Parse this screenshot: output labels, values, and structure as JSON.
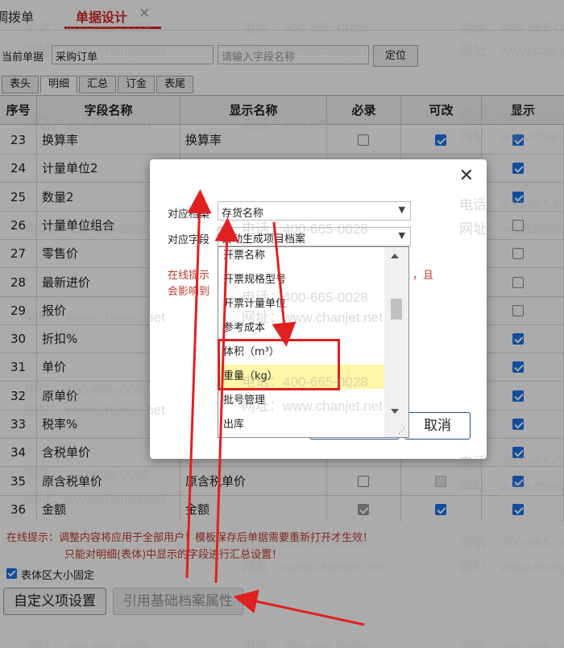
{
  "top_tabs": {
    "prev": "调拨单",
    "active": "单据设计",
    "close": "×"
  },
  "current": {
    "label": "当前单据",
    "value": "采购订单",
    "search_placeholder": "请输入字段名称",
    "locate": "定位"
  },
  "sub_tabs": [
    "表头",
    "明细",
    "汇总",
    "订金",
    "表尾"
  ],
  "table": {
    "headers": [
      "序号",
      "字段名称",
      "显示名称",
      "必录",
      "可改",
      "显示"
    ],
    "rows": [
      {
        "no": "23",
        "field": "换算率",
        "disp": "换算率",
        "req": "off",
        "edit": "on",
        "show": "on"
      },
      {
        "no": "24",
        "field": "计量单位2",
        "disp": "",
        "req": "none",
        "edit": "none",
        "show": "on"
      },
      {
        "no": "25",
        "field": "数量2",
        "disp": "",
        "req": "none",
        "edit": "none",
        "show": "on"
      },
      {
        "no": "26",
        "field": "计量单位组合",
        "disp": "",
        "req": "none",
        "edit": "none",
        "show": "off"
      },
      {
        "no": "27",
        "field": "零售价",
        "disp": "",
        "req": "none",
        "edit": "none",
        "show": "off"
      },
      {
        "no": "28",
        "field": "最新进价",
        "disp": "",
        "req": "none",
        "edit": "none",
        "show": "off"
      },
      {
        "no": "29",
        "field": "报价",
        "disp": "",
        "req": "none",
        "edit": "none",
        "show": "off"
      },
      {
        "no": "30",
        "field": "折扣%",
        "disp": "",
        "req": "none",
        "edit": "none",
        "show": "on"
      },
      {
        "no": "31",
        "field": "单价",
        "disp": "",
        "req": "none",
        "edit": "none",
        "show": "on"
      },
      {
        "no": "32",
        "field": "原单价",
        "disp": "",
        "req": "none",
        "edit": "none",
        "show": "on"
      },
      {
        "no": "33",
        "field": "税率%",
        "disp": "",
        "req": "none",
        "edit": "none",
        "show": "on"
      },
      {
        "no": "34",
        "field": "含税单价",
        "disp": "含税单价",
        "req": "dison",
        "edit": "on",
        "show": "on"
      },
      {
        "no": "35",
        "field": "原含税单价",
        "disp": "原含税单价",
        "req": "off",
        "edit": "dis",
        "show": "on"
      },
      {
        "no": "36",
        "field": "金额",
        "disp": "金额",
        "req": "dison",
        "edit": "on",
        "show": "on"
      }
    ]
  },
  "tips": {
    "line1": "在线提示：调整内容将应用于全部用户！模板保存后单据需要重新打开才生效！",
    "line2": "只能对明细(表体)中显示的字段进行汇总设置！",
    "fixed_label": "表体区大小固定"
  },
  "buttons": {
    "custom": "自定义项设置",
    "ref": "引用基础档案属性"
  },
  "modal": {
    "close": "✕",
    "archive_label": "对应档案",
    "archive_value": "存货名称",
    "field_label": "对应字段",
    "field_value": "自动生成项目档案",
    "tip_left1": "在线提示",
    "tip_left2": "会影响到",
    "tip_right": "，且",
    "cancel": "取消"
  },
  "dropdown": {
    "items": [
      "开票名称",
      "开票规格型号",
      "开票计量单位",
      "参考成本",
      "体积（m³）",
      "重量（kg）",
      "批号管理",
      "出库"
    ],
    "highlighted": "重量（kg）"
  },
  "watermark": {
    "phone": "电话：400-665-0028",
    "site": "网址：www.chanjet.net"
  },
  "colors": {
    "accent_red": "#d9262a",
    "check_blue": "#1a73e8",
    "tip_red": "#c0392b",
    "annot_red": "#e02020",
    "highlight": "#fff6a8"
  }
}
